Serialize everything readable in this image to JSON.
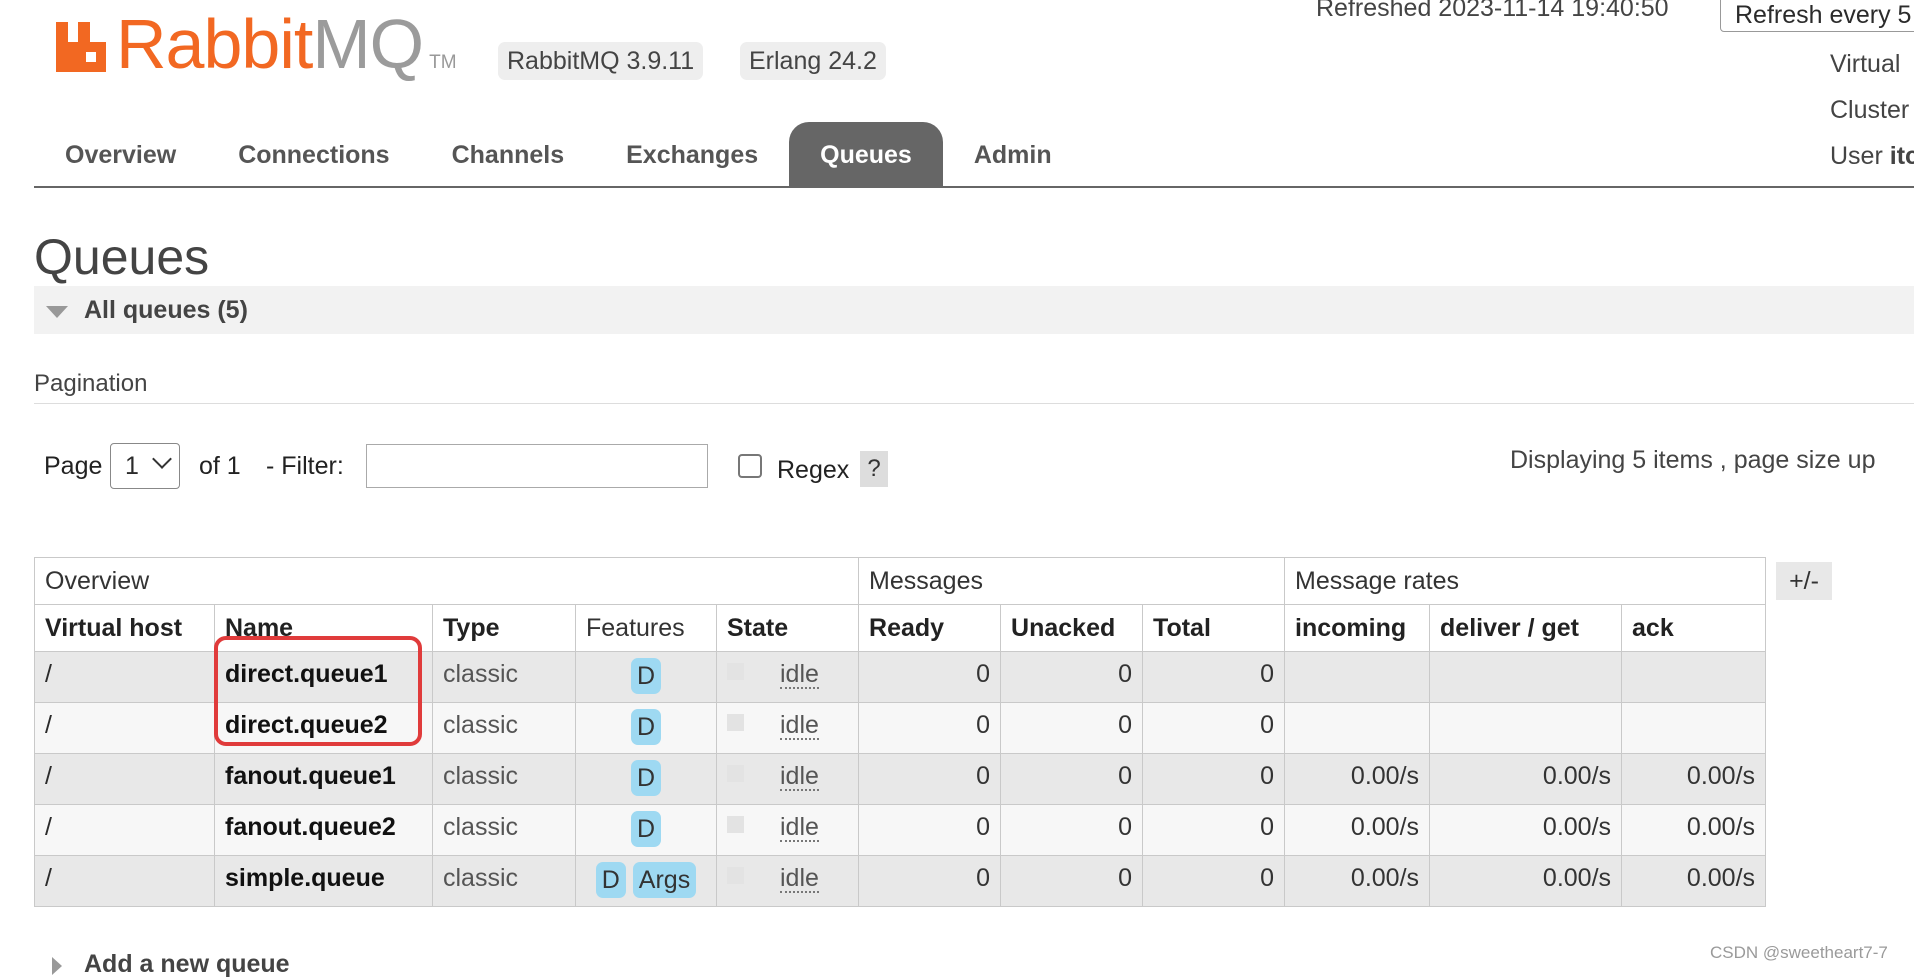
{
  "header": {
    "logo_primary": "Rabbit",
    "logo_secondary": "MQ",
    "logo_tm": "TM",
    "version_rabbitmq": "RabbitMQ 3.9.11",
    "version_erlang": "Erlang 24.2",
    "refreshed": "Refreshed 2023-11-14 19:40:50",
    "refresh_select": "Refresh every 5",
    "virtual_host_label": "Virtual",
    "cluster_label": "Cluster",
    "user_label": "User",
    "user_value": "itc"
  },
  "nav": {
    "tabs": [
      "Overview",
      "Connections",
      "Channels",
      "Exchanges",
      "Queues",
      "Admin"
    ],
    "active": "Queues"
  },
  "page": {
    "title": "Queues",
    "section": "All queues (5)",
    "pagination_heading": "Pagination",
    "page_label": "Page",
    "page_value": "1",
    "of_label": "of 1",
    "filter_label": "- Filter:",
    "filter_value": "",
    "regex_label": "Regex",
    "help_label": "?",
    "displaying": "Displaying 5 items , page size up",
    "add_queue": "Add a new queue",
    "watermark": "CSDN @sweetheart7-7",
    "plus_minus": "+/-"
  },
  "table": {
    "groups": [
      "Overview",
      "Messages",
      "Message rates"
    ],
    "columns": [
      "Virtual host",
      "Name",
      "Type",
      "Features",
      "State",
      "Ready",
      "Unacked",
      "Total",
      "incoming",
      "deliver / get",
      "ack"
    ],
    "rows": [
      {
        "vhost": "/",
        "name": "direct.queue1",
        "type": "classic",
        "features": [
          "D"
        ],
        "state": "idle",
        "ready": "0",
        "unacked": "0",
        "total": "0",
        "incoming": "",
        "deliver_get": "",
        "ack": ""
      },
      {
        "vhost": "/",
        "name": "direct.queue2",
        "type": "classic",
        "features": [
          "D"
        ],
        "state": "idle",
        "ready": "0",
        "unacked": "0",
        "total": "0",
        "incoming": "",
        "deliver_get": "",
        "ack": ""
      },
      {
        "vhost": "/",
        "name": "fanout.queue1",
        "type": "classic",
        "features": [
          "D"
        ],
        "state": "idle",
        "ready": "0",
        "unacked": "0",
        "total": "0",
        "incoming": "0.00/s",
        "deliver_get": "0.00/s",
        "ack": "0.00/s"
      },
      {
        "vhost": "/",
        "name": "fanout.queue2",
        "type": "classic",
        "features": [
          "D"
        ],
        "state": "idle",
        "ready": "0",
        "unacked": "0",
        "total": "0",
        "incoming": "0.00/s",
        "deliver_get": "0.00/s",
        "ack": "0.00/s"
      },
      {
        "vhost": "/",
        "name": "simple.queue",
        "type": "classic",
        "features": [
          "D",
          "Args"
        ],
        "state": "idle",
        "ready": "0",
        "unacked": "0",
        "total": "0",
        "incoming": "0.00/s",
        "deliver_get": "0.00/s",
        "ack": "0.00/s"
      }
    ]
  },
  "colors": {
    "brand_orange": "#f26822",
    "tab_active": "#666666",
    "feature_badge": "#9ed9f2",
    "highlight_box": "#e03b3b"
  }
}
